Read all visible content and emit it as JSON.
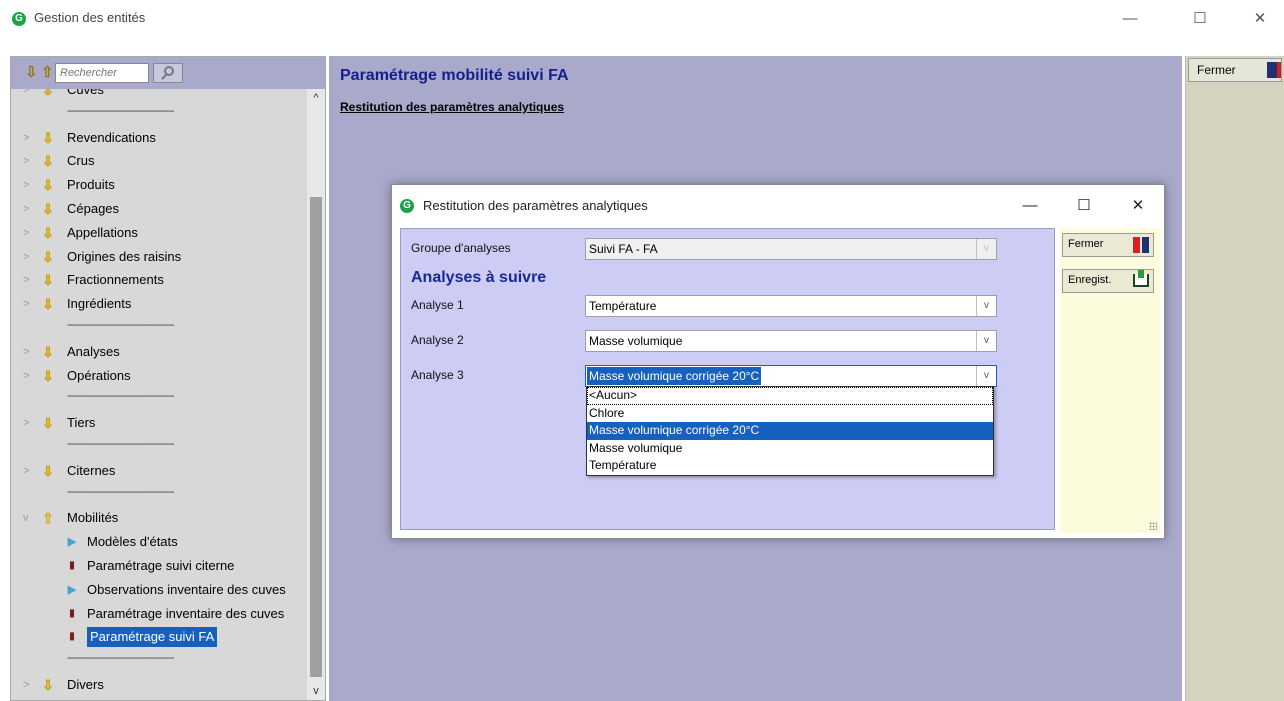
{
  "window": {
    "title": "Gestion des entités",
    "minimize": "—",
    "maximize": "☐",
    "close": "✕"
  },
  "search": {
    "placeholder": "Rechercher"
  },
  "tree": {
    "items": [
      {
        "label": "Cuves",
        "type": "down"
      },
      {
        "label": "----------------------------------------",
        "type": "sep"
      },
      {
        "label": "Revendications",
        "type": "down"
      },
      {
        "label": "Crus",
        "type": "down"
      },
      {
        "label": "Produits",
        "type": "down"
      },
      {
        "label": "Cépages",
        "type": "down"
      },
      {
        "label": "Appellations",
        "type": "down"
      },
      {
        "label": "Origines des raisins",
        "type": "down"
      },
      {
        "label": "Fractionnements",
        "type": "down"
      },
      {
        "label": "Ingrédients",
        "type": "down"
      },
      {
        "label": "----------------------------------------",
        "type": "sep"
      },
      {
        "label": "Analyses",
        "type": "down"
      },
      {
        "label": "Opérations",
        "type": "down"
      },
      {
        "label": "----------------------------------------",
        "type": "sep"
      },
      {
        "label": "Tiers",
        "type": "down"
      },
      {
        "label": "----------------------------------------",
        "type": "sep"
      },
      {
        "label": "Citernes",
        "type": "down"
      },
      {
        "label": "----------------------------------------",
        "type": "sep"
      },
      {
        "label": "Mobilités",
        "type": "up"
      },
      {
        "label": "Modèles d'états",
        "type": "child-play"
      },
      {
        "label": "Paramétrage suivi citerne",
        "type": "child-bar"
      },
      {
        "label": "Observations inventaire des cuves",
        "type": "child-play"
      },
      {
        "label": "Paramétrage inventaire des cuves",
        "type": "child-bar"
      },
      {
        "label": "Paramétrage suivi FA",
        "type": "child-bar-selected"
      },
      {
        "label": "----------------------------------------",
        "type": "sep"
      },
      {
        "label": "Divers",
        "type": "down"
      }
    ]
  },
  "main": {
    "title": "Paramétrage mobilité suivi FA",
    "link": "Restitution des paramètres analytiques"
  },
  "right": {
    "close_label": "Fermer"
  },
  "dialog": {
    "title": "Restitution des paramètres analytiques",
    "group_label": "Groupe d'analyses",
    "group_value": "Suivi FA - FA",
    "section": "Analyses à suivre",
    "analyse1_label": "Analyse 1",
    "analyse1_value": "Température",
    "analyse2_label": "Analyse 2",
    "analyse2_value": "Masse volumique",
    "analyse3_label": "Analyse 3",
    "analyse3_value": "Masse volumique corrigée 20°C",
    "options": [
      "<Aucun>",
      "Chlore",
      "Masse volumique corrigée 20°C",
      "Masse volumique",
      "Température"
    ],
    "selected_option": 2,
    "close_label": "Fermer",
    "save_label": "Enregist."
  }
}
